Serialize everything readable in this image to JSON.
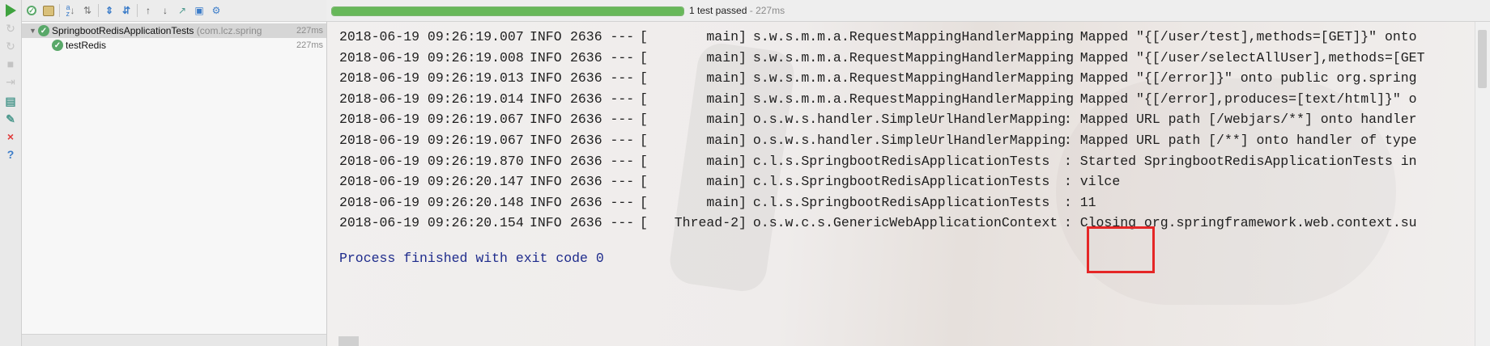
{
  "left_toolbar": {
    "icons": [
      "run-icon",
      "rerun-icon",
      "rerun-failed-icon",
      "stop-icon",
      "exit-icon",
      "layout-icon",
      "pin-icon",
      "close-icon",
      "help-icon"
    ]
  },
  "top_toolbar": {
    "icons": [
      "show-passed-icon",
      "show-ignored-icon",
      "sort-alpha-icon",
      "sort-duration-icon",
      "expand-all-icon",
      "collapse-all-icon",
      "previous-icon",
      "next-icon",
      "export-icon",
      "import-icon",
      "settings-icon"
    ]
  },
  "status": {
    "progress": 1.0,
    "text": "1 test passed",
    "time": "227ms",
    "separator": " - "
  },
  "tree": {
    "root": {
      "label": "SpringbootRedisApplicationTests",
      "package": "(com.lcz.spring",
      "time": "227ms"
    },
    "child": {
      "label": "testRedis",
      "time": "227ms"
    }
  },
  "console": {
    "lines": [
      {
        "ts": "2018-06-19 09:26:19.007",
        "level": "INFO",
        "pid": "2636 ---",
        "bracket": "[",
        "thread": "main]",
        "logger": "s.w.s.m.m.a.RequestMappingHandlerMapping",
        "msg": ": Mapped \"{[/user/test],methods=[GET]}\" onto"
      },
      {
        "ts": "2018-06-19 09:26:19.008",
        "level": "INFO",
        "pid": "2636 ---",
        "bracket": "[",
        "thread": "main]",
        "logger": "s.w.s.m.m.a.RequestMappingHandlerMapping",
        "msg": ": Mapped \"{[/user/selectAllUser],methods=[GET"
      },
      {
        "ts": "2018-06-19 09:26:19.013",
        "level": "INFO",
        "pid": "2636 ---",
        "bracket": "[",
        "thread": "main]",
        "logger": "s.w.s.m.m.a.RequestMappingHandlerMapping",
        "msg": ": Mapped \"{[/error]}\" onto public org.spring"
      },
      {
        "ts": "2018-06-19 09:26:19.014",
        "level": "INFO",
        "pid": "2636 ---",
        "bracket": "[",
        "thread": "main]",
        "logger": "s.w.s.m.m.a.RequestMappingHandlerMapping",
        "msg": ": Mapped \"{[/error],produces=[text/html]}\" o"
      },
      {
        "ts": "2018-06-19 09:26:19.067",
        "level": "INFO",
        "pid": "2636 ---",
        "bracket": "[",
        "thread": "main]",
        "logger": "o.s.w.s.handler.SimpleUrlHandlerMapping",
        "msg": ": Mapped URL path [/webjars/**] onto handler"
      },
      {
        "ts": "2018-06-19 09:26:19.067",
        "level": "INFO",
        "pid": "2636 ---",
        "bracket": "[",
        "thread": "main]",
        "logger": "o.s.w.s.handler.SimpleUrlHandlerMapping",
        "msg": ": Mapped URL path [/**] onto handler of type"
      },
      {
        "ts": "2018-06-19 09:26:19.870",
        "level": "INFO",
        "pid": "2636 ---",
        "bracket": "[",
        "thread": "main]",
        "logger": "c.l.s.SpringbootRedisApplicationTests",
        "msg": ": Started SpringbootRedisApplicationTests in"
      },
      {
        "ts": "2018-06-19 09:26:20.147",
        "level": "INFO",
        "pid": "2636 ---",
        "bracket": "[",
        "thread": "main]",
        "logger": "c.l.s.SpringbootRedisApplicationTests",
        "msg": ": vilce"
      },
      {
        "ts": "2018-06-19 09:26:20.148",
        "level": "INFO",
        "pid": "2636 ---",
        "bracket": "[",
        "thread": "main]",
        "logger": "c.l.s.SpringbootRedisApplicationTests",
        "msg": ": 11"
      },
      {
        "ts": "2018-06-19 09:26:20.154",
        "level": "INFO",
        "pid": "2636 ---",
        "bracket": "[",
        "thread": "Thread-2]",
        "logger": "o.s.w.c.s.GenericWebApplicationContext",
        "msg": ": Closing org.springframework.web.context.su"
      }
    ],
    "exit_message": "Process finished with exit code 0"
  },
  "colors": {
    "highlight": "#e52626",
    "pass_green": "#59a869",
    "exit_text": "#1e2b8c"
  }
}
